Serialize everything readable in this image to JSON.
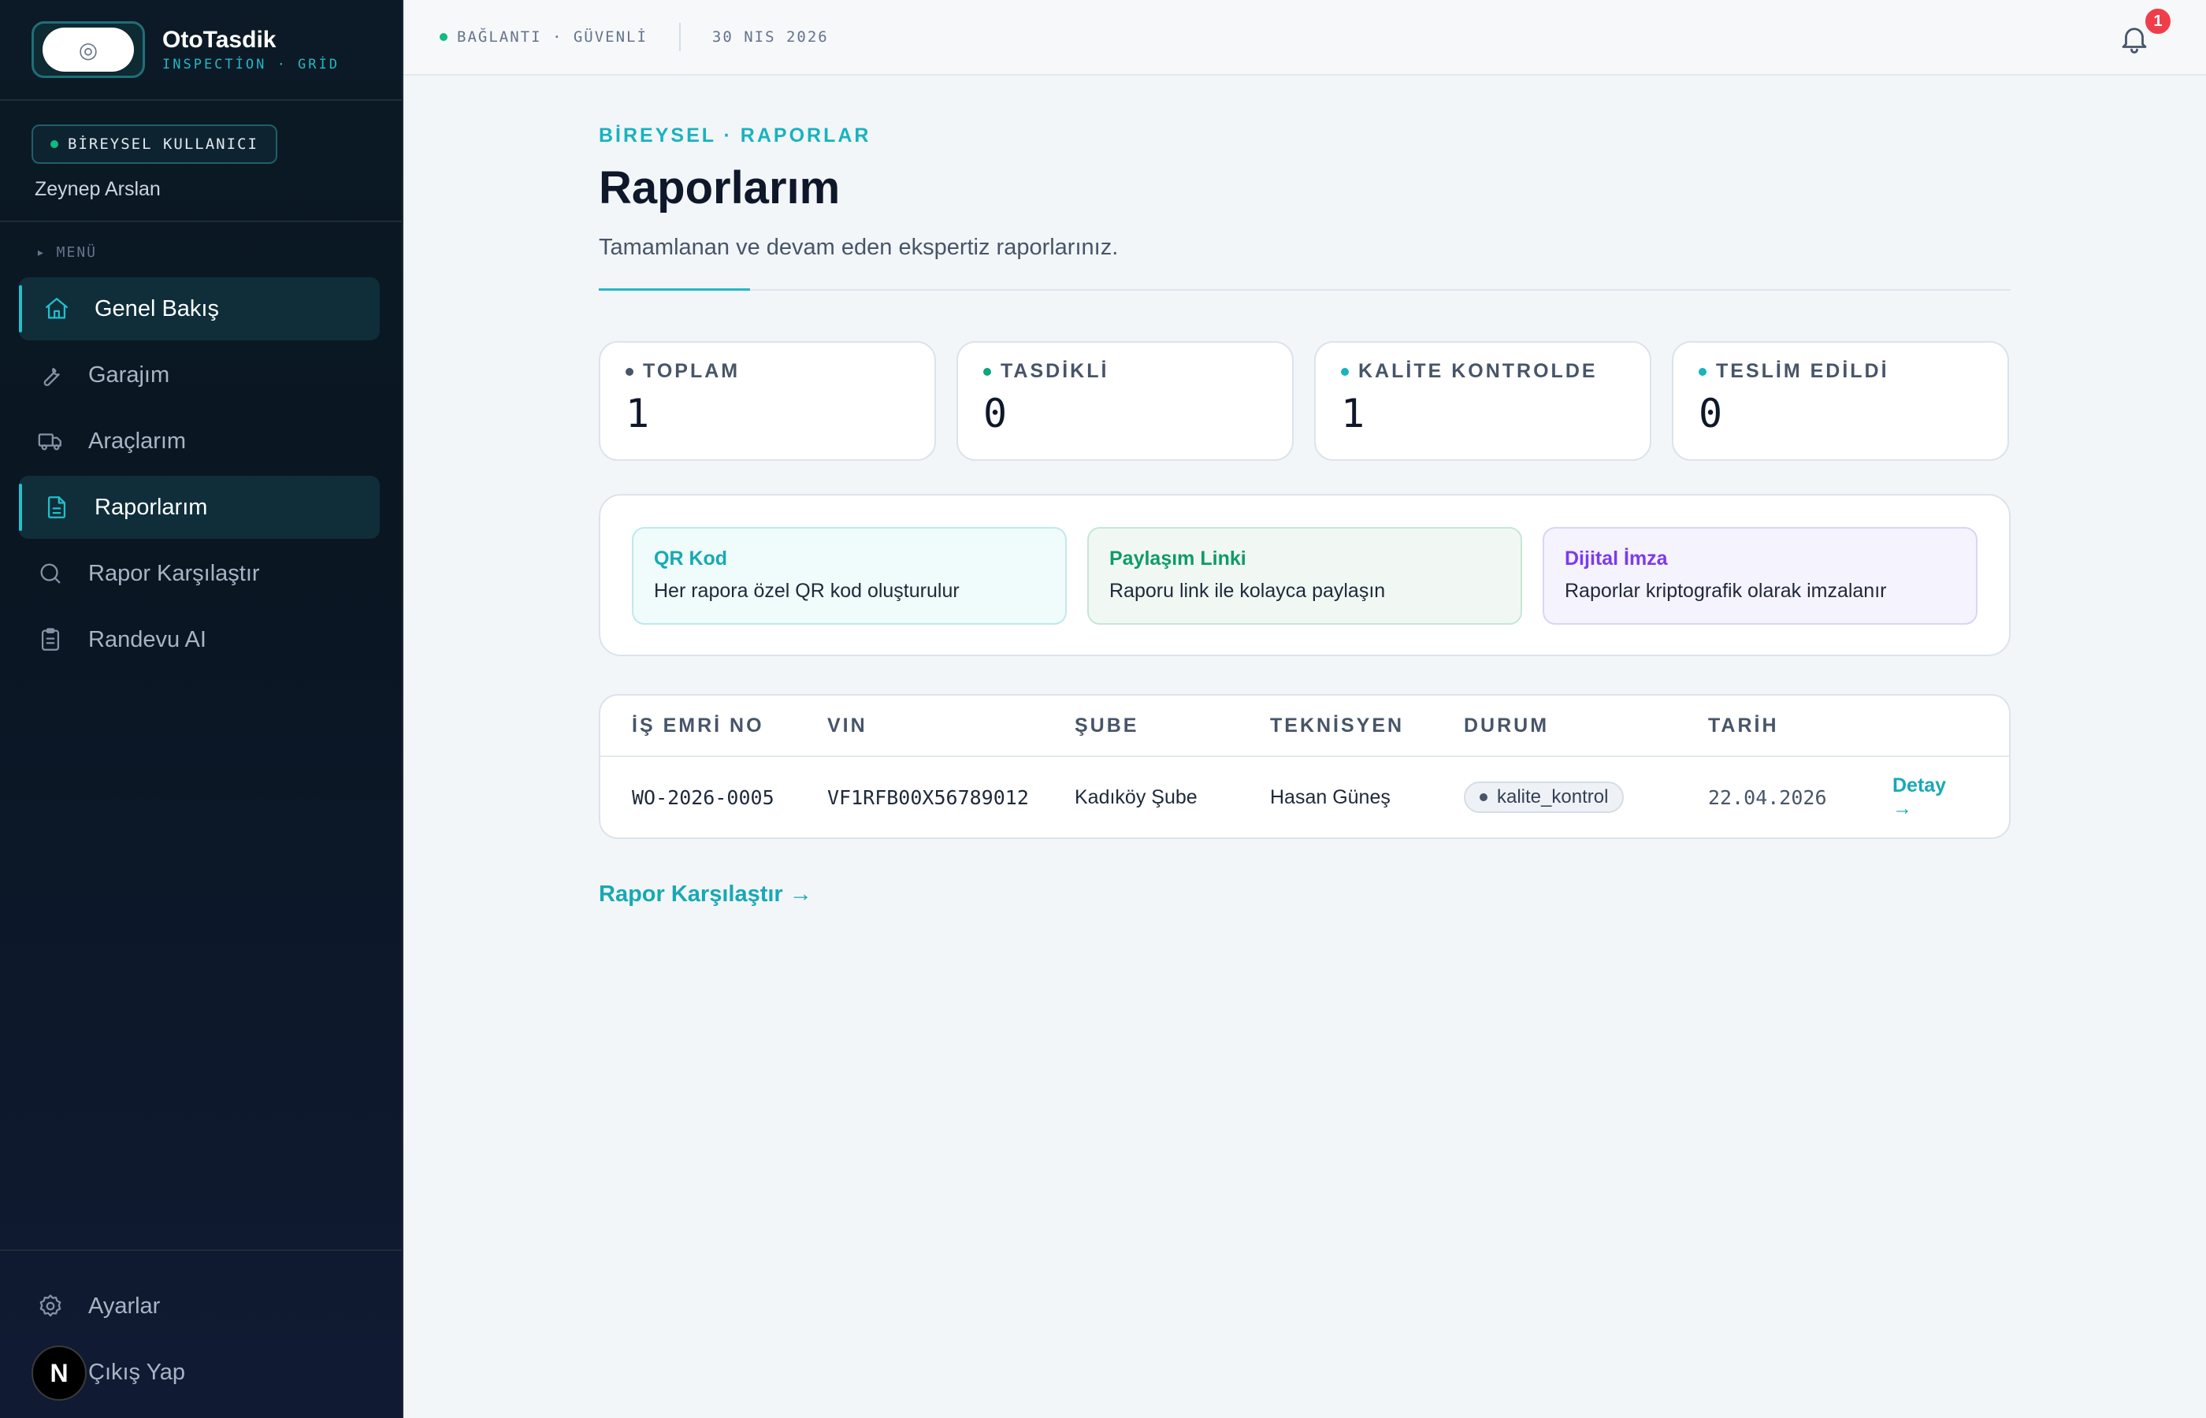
{
  "brand": {
    "name": "OtoTasdik",
    "sub": "INSPECTİON · GRİD",
    "logo_glyph": "◎"
  },
  "user": {
    "badge": "BİREYSEL KULLANICI",
    "name": "Zeynep Arslan"
  },
  "menu": {
    "label": "▸ MENÜ",
    "items": [
      {
        "label": "Genel Bakış",
        "icon": "home-icon"
      },
      {
        "label": "Garajım",
        "icon": "wrench-icon"
      },
      {
        "label": "Araçlarım",
        "icon": "truck-icon"
      },
      {
        "label": "Raporlarım",
        "icon": "document-icon"
      },
      {
        "label": "Rapor Karşılaştır",
        "icon": "search-icon"
      },
      {
        "label": "Randevu AI",
        "icon": "clipboard-icon"
      }
    ]
  },
  "sidebar_bottom": {
    "settings": "Ayarlar",
    "logout": "Çıkış Yap",
    "badge": "N"
  },
  "topbar": {
    "connection": "BAĞLANTI · GÜVENLİ",
    "date": "30 NIS 2026",
    "notification_count": "1"
  },
  "page": {
    "breadcrumb": "BİREYSEL · RAPORLAR",
    "title": "Raporlarım",
    "subtitle": "Tamamlanan ve devam eden ekspertiz raporlarınız."
  },
  "stats": [
    {
      "label": "TOPLAM",
      "value": "1",
      "dot_color": "#475569"
    },
    {
      "label": "TASDİKLİ",
      "value": "0",
      "dot_color": "#10a37f"
    },
    {
      "label": "KALİTE KONTROLDE",
      "value": "1",
      "dot_color": "#17b3bf"
    },
    {
      "label": "TESLİM EDİLDİ",
      "value": "0",
      "dot_color": "#17b3bf"
    }
  ],
  "features": [
    {
      "title": "QR Kod",
      "desc": "Her rapora özel QR kod oluşturulur",
      "color": "#17a9b5",
      "bg": "#f0fbfb",
      "border": "#bfe9ec"
    },
    {
      "title": "Paylaşım Linki",
      "desc": "Raporu link ile kolayca paylaşın",
      "color": "#0f9a6c",
      "bg": "#f1f8f4",
      "border": "#c6e6d6"
    },
    {
      "title": "Dijital İmza",
      "desc": "Raporlar kriptografik olarak imzalanır",
      "color": "#7c3aed",
      "bg": "#f5f3fd",
      "border": "#ddd3f7"
    }
  ],
  "table": {
    "headers": [
      "İŞ EMRİ NO",
      "VIN",
      "ŞUBE",
      "TEKNİSYEN",
      "DURUM",
      "TARİH"
    ],
    "rows": [
      {
        "order": "WO-2026-0005",
        "vin": "VF1RFB00X56789012",
        "branch": "Kadıköy Şube",
        "technician": "Hasan Güneş",
        "status": "kalite_kontrol",
        "date": "22.04.2026",
        "action": "Detay →"
      }
    ]
  },
  "compare_link": "Rapor Karşılaştır →"
}
